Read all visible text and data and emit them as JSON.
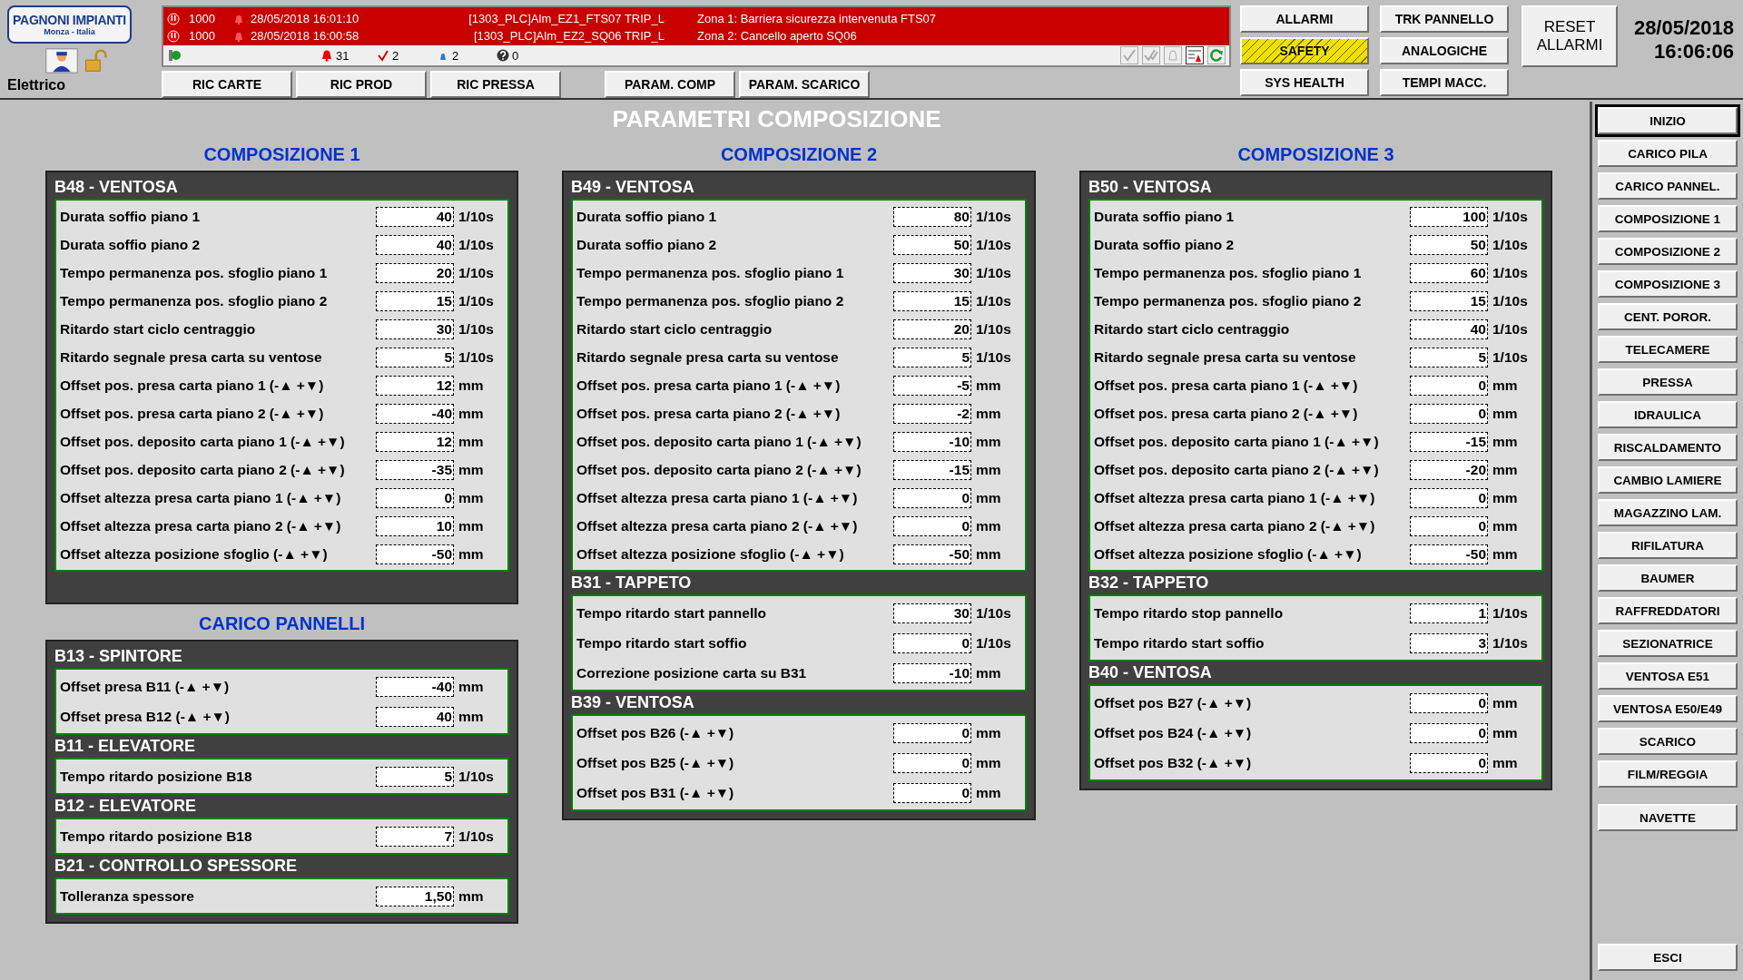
{
  "logo": {
    "name": "PAGNONI IMPIANTI",
    "place": "Monza - Italia"
  },
  "user": {
    "role": "Elettrico",
    "locked": false
  },
  "alarms": [
    {
      "priority": "1000",
      "time": "28/05/2018 16:01:10",
      "tag": "[1303_PLC]Alm_EZ1_FTS07 TRIP_L",
      "message": "Zona 1: Barriera sicurezza intervenuta FTS07"
    },
    {
      "priority": "1000",
      "time": "28/05/2018 16:00:58",
      "tag": "[1303_PLC]Alm_EZ2_SQ06 TRIP_L",
      "message": "Zona 2: Cancello aperto SQ06"
    }
  ],
  "alarm_counts": {
    "active": "31",
    "acknowledged": "2",
    "warnings": "2",
    "unknown": "0"
  },
  "nav_groups": [
    [
      "RIC CARTE",
      "RIC PROD",
      "RIC PRESSA"
    ],
    [
      "PARAM. COMP",
      "PARAM. SCARICO"
    ]
  ],
  "function_buttons": [
    {
      "label": "ALLARMI",
      "alert": false
    },
    {
      "label": "TRK PANNELLO",
      "alert": false
    },
    {
      "label": "SAFETY",
      "alert": true
    },
    {
      "label": "ANALOGICHE",
      "alert": false
    },
    {
      "label": "SYS HEALTH",
      "alert": false
    },
    {
      "label": "TEMPI MACC.",
      "alert": false
    }
  ],
  "reset_button": "RESET ALLARMI",
  "clock": {
    "date": "28/05/2018",
    "time": "16:06:06"
  },
  "page_title": "PARAMETRI COMPOSIZIONE",
  "columns": [
    {
      "groups": [
        {
          "heading": "COMPOSIZIONE 1",
          "sections": [
            {
              "title": "B48 - VENTOSA",
              "rows": [
                {
                  "label": "Durata soffio piano 1",
                  "value": "40",
                  "unit": "1/10s"
                },
                {
                  "label": "Durata soffio piano 2",
                  "value": "40",
                  "unit": "1/10s"
                },
                {
                  "label": "Tempo permanenza pos. sfoglio piano 1",
                  "value": "20",
                  "unit": "1/10s"
                },
                {
                  "label": "Tempo permanenza pos. sfoglio piano 2",
                  "value": "15",
                  "unit": "1/10s"
                },
                {
                  "label": "Ritardo start ciclo centraggio",
                  "value": "30",
                  "unit": "1/10s"
                },
                {
                  "label": "Ritardo segnale presa carta su ventose",
                  "value": "5",
                  "unit": "1/10s"
                },
                {
                  "label": "Offset pos. presa carta piano 1 (-▲ +▼)",
                  "value": "12",
                  "unit": "mm"
                },
                {
                  "label": "Offset pos. presa carta piano 2 (-▲ +▼)",
                  "value": "-40",
                  "unit": "mm"
                },
                {
                  "label": "Offset pos. deposito carta piano 1 (-▲ +▼)",
                  "value": "12",
                  "unit": "mm"
                },
                {
                  "label": "Offset pos. deposito carta piano 2 (-▲ +▼)",
                  "value": "-35",
                  "unit": "mm"
                },
                {
                  "label": "Offset altezza presa carta piano 1 (-▲ +▼)",
                  "value": "0",
                  "unit": "mm"
                },
                {
                  "label": "Offset altezza presa carta piano 2 (-▲ +▼)",
                  "value": "10",
                  "unit": "mm"
                },
                {
                  "label": "Offset altezza posizione sfoglio (-▲ +▼)",
                  "value": "-50",
                  "unit": "mm"
                }
              ]
            }
          ]
        },
        {
          "heading": "CARICO PANNELLI",
          "sections": [
            {
              "title": "B13 - SPINTORE",
              "rows": [
                {
                  "label": "Offset presa B11  (-▲ +▼)",
                  "value": "-40",
                  "unit": "mm"
                },
                {
                  "label": "Offset presa B12  (-▲ +▼)",
                  "value": "40",
                  "unit": "mm"
                }
              ]
            },
            {
              "title": "B11 - ELEVATORE",
              "rows": [
                {
                  "label": "Tempo ritardo posizione B18",
                  "value": "5",
                  "unit": "1/10s"
                }
              ]
            },
            {
              "title": "B12 - ELEVATORE",
              "rows": [
                {
                  "label": "Tempo ritardo posizione B18",
                  "value": "7",
                  "unit": "1/10s"
                }
              ]
            },
            {
              "title": "B21 - CONTROLLO SPESSORE",
              "rows": [
                {
                  "label": "Tolleranza spessore",
                  "value": "1,50",
                  "unit": "mm"
                }
              ]
            }
          ]
        }
      ]
    },
    {
      "groups": [
        {
          "heading": "COMPOSIZIONE 2",
          "sections": [
            {
              "title": "B49 - VENTOSA",
              "rows": [
                {
                  "label": "Durata soffio piano 1",
                  "value": "80",
                  "unit": "1/10s"
                },
                {
                  "label": "Durata soffio piano 2",
                  "value": "50",
                  "unit": "1/10s"
                },
                {
                  "label": "Tempo permanenza pos. sfoglio piano 1",
                  "value": "30",
                  "unit": "1/10s"
                },
                {
                  "label": "Tempo permanenza pos. sfoglio piano 2",
                  "value": "15",
                  "unit": "1/10s"
                },
                {
                  "label": "Ritardo start ciclo centraggio",
                  "value": "20",
                  "unit": "1/10s"
                },
                {
                  "label": "Ritardo segnale presa carta su ventose",
                  "value": "5",
                  "unit": "1/10s"
                },
                {
                  "label": "Offset pos. presa carta piano 1 (-▲ +▼)",
                  "value": "-5",
                  "unit": "mm"
                },
                {
                  "label": "Offset pos. presa carta piano 2 (-▲ +▼)",
                  "value": "-2",
                  "unit": "mm"
                },
                {
                  "label": "Offset pos. deposito carta piano 1 (-▲ +▼)",
                  "value": "-10",
                  "unit": "mm"
                },
                {
                  "label": "Offset pos. deposito carta piano 2 (-▲ +▼)",
                  "value": "-15",
                  "unit": "mm"
                },
                {
                  "label": "Offset altezza presa carta piano 1 (-▲ +▼)",
                  "value": "0",
                  "unit": "mm"
                },
                {
                  "label": "Offset altezza presa carta piano 2 (-▲ +▼)",
                  "value": "0",
                  "unit": "mm"
                },
                {
                  "label": "Offset altezza posizione sfoglio (-▲ +▼)",
                  "value": "-50",
                  "unit": "mm"
                }
              ]
            },
            {
              "title": "B31 - TAPPETO",
              "rows": [
                {
                  "label": "Tempo ritardo start pannello",
                  "value": "30",
                  "unit": "1/10s"
                },
                {
                  "label": "Tempo ritardo start soffio",
                  "value": "0",
                  "unit": "1/10s"
                },
                {
                  "label": "Correzione posizione carta su B31",
                  "value": "-10",
                  "unit": "mm"
                }
              ]
            },
            {
              "title": "B39 - VENTOSA",
              "rows": [
                {
                  "label": "Offset pos B26  (-▲ +▼)",
                  "value": "0",
                  "unit": "mm"
                },
                {
                  "label": "Offset pos B25  (-▲ +▼)",
                  "value": "0",
                  "unit": "mm"
                },
                {
                  "label": "Offset pos B31  (-▲ +▼)",
                  "value": "0",
                  "unit": "mm"
                }
              ]
            }
          ]
        }
      ]
    },
    {
      "groups": [
        {
          "heading": "COMPOSIZIONE 3",
          "sections": [
            {
              "title": "B50 - VENTOSA",
              "rows": [
                {
                  "label": "Durata soffio piano 1",
                  "value": "100",
                  "unit": "1/10s"
                },
                {
                  "label": "Durata soffio piano 2",
                  "value": "50",
                  "unit": "1/10s"
                },
                {
                  "label": "Tempo permanenza pos. sfoglio piano 1",
                  "value": "60",
                  "unit": "1/10s"
                },
                {
                  "label": "Tempo permanenza pos. sfoglio piano 2",
                  "value": "15",
                  "unit": "1/10s"
                },
                {
                  "label": "Ritardo start ciclo centraggio",
                  "value": "40",
                  "unit": "1/10s"
                },
                {
                  "label": "Ritardo segnale presa carta su ventose",
                  "value": "5",
                  "unit": "1/10s"
                },
                {
                  "label": "Offset pos. presa carta piano 1 (-▲ +▼)",
                  "value": "0",
                  "unit": "mm"
                },
                {
                  "label": "Offset pos. presa carta piano 2 (-▲ +▼)",
                  "value": "0",
                  "unit": "mm"
                },
                {
                  "label": "Offset pos. deposito carta piano 1 (-▲ +▼)",
                  "value": "-15",
                  "unit": "mm"
                },
                {
                  "label": "Offset pos. deposito carta piano 2 (-▲ +▼)",
                  "value": "-20",
                  "unit": "mm"
                },
                {
                  "label": "Offset altezza presa carta piano 1 (-▲ +▼)",
                  "value": "0",
                  "unit": "mm"
                },
                {
                  "label": "Offset altezza presa carta piano 2 (-▲ +▼)",
                  "value": "0",
                  "unit": "mm"
                },
                {
                  "label": "Offset altezza posizione sfoglio (-▲ +▼)",
                  "value": "-50",
                  "unit": "mm"
                }
              ]
            },
            {
              "title": "B32 - TAPPETO",
              "rows": [
                {
                  "label": "Tempo ritardo stop pannello",
                  "value": "1",
                  "unit": "1/10s"
                },
                {
                  "label": "Tempo ritardo start soffio",
                  "value": "3",
                  "unit": "1/10s"
                }
              ]
            },
            {
              "title": "B40 - VENTOSA",
              "rows": [
                {
                  "label": "Offset pos B27  (-▲ +▼)",
                  "value": "0",
                  "unit": "mm"
                },
                {
                  "label": "Offset pos B24  (-▲ +▼)",
                  "value": "0",
                  "unit": "mm"
                },
                {
                  "label": "Offset pos B32  (-▲ +▼)",
                  "value": "0",
                  "unit": "mm"
                }
              ]
            }
          ]
        }
      ]
    }
  ],
  "sidebar": {
    "items": [
      {
        "label": "INIZIO",
        "selected": true
      },
      {
        "label": "CARICO PILA",
        "selected": false
      },
      {
        "label": "CARICO PANNEL.",
        "selected": false
      },
      {
        "label": "COMPOSIZIONE 1",
        "selected": false
      },
      {
        "label": "COMPOSIZIONE 2",
        "selected": false
      },
      {
        "label": "COMPOSIZIONE 3",
        "selected": false
      },
      {
        "label": "CENT. POROR.",
        "selected": false
      },
      {
        "label": "TELECAMERE",
        "selected": false
      },
      {
        "label": "PRESSA",
        "selected": false
      },
      {
        "label": "IDRAULICA",
        "selected": false
      },
      {
        "label": "RISCALDAMENTO",
        "selected": false
      },
      {
        "label": "CAMBIO LAMIERE",
        "selected": false
      },
      {
        "label": "MAGAZZINO LAM.",
        "selected": false
      },
      {
        "label": "RIFILATURA",
        "selected": false
      },
      {
        "label": "BAUMER",
        "selected": false
      },
      {
        "label": "RAFFREDDATORI",
        "selected": false
      },
      {
        "label": "SEZIONATRICE",
        "selected": false
      },
      {
        "label": "VENTOSA E51",
        "selected": false
      },
      {
        "label": "VENTOSA E50/E49",
        "selected": false
      },
      {
        "label": "SCARICO",
        "selected": false
      },
      {
        "label": "FILM/REGGIA",
        "selected": false
      }
    ],
    "extra": "NAVETTE",
    "exit": "ESCI"
  }
}
